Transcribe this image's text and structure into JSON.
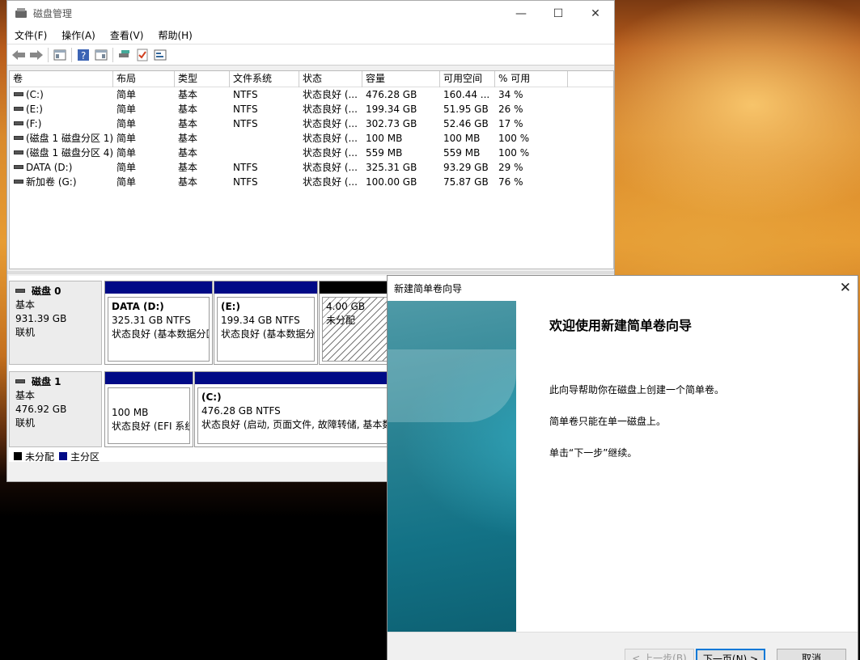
{
  "window": {
    "title": "磁盘管理",
    "controls": {
      "minimize": "—",
      "maximize": "☐",
      "close": "✕"
    }
  },
  "menu": [
    "文件(F)",
    "操作(A)",
    "查看(V)",
    "帮助(H)"
  ],
  "toolbar_icons": [
    "back-icon",
    "forward-icon",
    "properties-icon",
    "help-icon",
    "view-icon",
    "disk-icon",
    "check-icon",
    "settings-icon"
  ],
  "volume_table": {
    "headers": [
      "卷",
      "布局",
      "类型",
      "文件系统",
      "状态",
      "容量",
      "可用空间",
      "% 可用"
    ],
    "rows": [
      [
        "(C:)",
        "简单",
        "基本",
        "NTFS",
        "状态良好 (...",
        "476.28 GB",
        "160.44 ...",
        "34 %"
      ],
      [
        "(E:)",
        "简单",
        "基本",
        "NTFS",
        "状态良好 (...",
        "199.34 GB",
        "51.95 GB",
        "26 %"
      ],
      [
        "(F:)",
        "简单",
        "基本",
        "NTFS",
        "状态良好 (...",
        "302.73 GB",
        "52.46 GB",
        "17 %"
      ],
      [
        "(磁盘 1 磁盘分区 1)",
        "简单",
        "基本",
        "",
        "状态良好 (...",
        "100 MB",
        "100 MB",
        "100 %"
      ],
      [
        "(磁盘 1 磁盘分区 4)",
        "简单",
        "基本",
        "",
        "状态良好 (...",
        "559 MB",
        "559 MB",
        "100 %"
      ],
      [
        "DATA (D:)",
        "简单",
        "基本",
        "NTFS",
        "状态良好 (...",
        "325.31 GB",
        "93.29 GB",
        "29 %"
      ],
      [
        "新加卷 (G:)",
        "简单",
        "基本",
        "NTFS",
        "状态良好 (...",
        "100.00 GB",
        "75.87 GB",
        "76 %"
      ]
    ]
  },
  "disks": [
    {
      "name": "磁盘 0",
      "type": "基本",
      "size": "931.39 GB",
      "status": "联机",
      "partitions": [
        {
          "name": "DATA  (D:)",
          "size": "325.31 GB NTFS",
          "status": "状态良好 (基本数据分区)"
        },
        {
          "name": "(E:)",
          "size": "199.34 GB NTFS",
          "status": "状态良好 (基本数据分区)"
        },
        {
          "name": "",
          "size": "4.00 GB",
          "status": "未分配"
        }
      ]
    },
    {
      "name": "磁盘 1",
      "type": "基本",
      "size": "476.92 GB",
      "status": "联机",
      "partitions": [
        {
          "name": "",
          "size": "100 MB",
          "status": "状态良好 (EFI 系统分区)"
        },
        {
          "name": "(C:)",
          "size": "476.28 GB NTFS",
          "status": "状态良好 (启动, 页面文件, 故障转储, 基本数据分区)"
        }
      ]
    }
  ],
  "legend": [
    {
      "label": "未分配",
      "color": "#000000"
    },
    {
      "label": "主分区",
      "color": "#000a86"
    }
  ],
  "wizard": {
    "title": "新建简单卷向导",
    "close": "✕",
    "heading": "欢迎使用新建简单卷向导",
    "paragraphs": [
      "此向导帮助你在磁盘上创建一个简单卷。",
      "简单卷只能在单一磁盘上。",
      "单击“下一步”继续。"
    ],
    "buttons": {
      "back": "< 上一步(B)",
      "next": "下一页(N) >",
      "cancel": "取消"
    }
  }
}
